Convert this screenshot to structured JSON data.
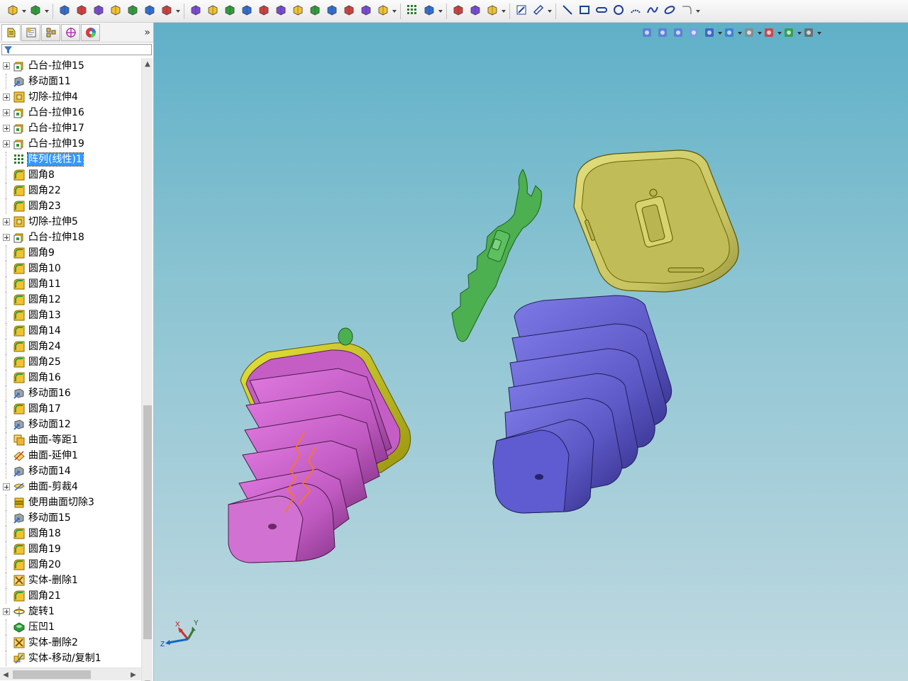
{
  "toolbar": {
    "groups": [
      [
        "boss-extrude-icon",
        "cut-extrude-icon"
      ],
      [
        "move-face-icon",
        "boss-icon",
        "revolve-icon",
        "sweep-icon",
        "loft-icon",
        "boundary-icon",
        "fillet-icon"
      ],
      [
        "extrude-surface-icon",
        "revolve-surface-icon",
        "sweep-surface-icon",
        "loft-surface-icon",
        "boundary-surface-icon",
        "fill-surface-icon",
        "offset-surface-icon",
        "extend-surface-icon",
        "trim-surface-icon",
        "thicken-icon",
        "cut-with-surface-icon",
        "knit-icon"
      ],
      [
        "linear-pattern-icon",
        "mirror-icon"
      ],
      [
        "reference-geometry-icon",
        "curves-icon",
        "instant3d-icon"
      ],
      [
        "sketch-icon",
        "smart-dimension-icon"
      ],
      [
        "line-icon",
        "rectangle-icon",
        "slot-icon",
        "circle-icon",
        "arc-icon",
        "spline-icon",
        "ellipse-icon",
        "trim-entities-icon"
      ]
    ]
  },
  "panel": {
    "tabs": [
      "feature-manager-icon",
      "property-manager-icon",
      "configuration-manager-icon",
      "dimxpert-manager-icon",
      "display-manager-icon"
    ],
    "expand_label": "»",
    "tree": [
      {
        "label": "凸台-拉伸15",
        "icon": "boss-extrude",
        "expandable": true
      },
      {
        "label": "移动面11",
        "icon": "move-face",
        "expandable": false
      },
      {
        "label": "切除-拉伸4",
        "icon": "cut-extrude",
        "expandable": true
      },
      {
        "label": "凸台-拉伸16",
        "icon": "boss-extrude",
        "expandable": true
      },
      {
        "label": "凸台-拉伸17",
        "icon": "boss-extrude",
        "expandable": true
      },
      {
        "label": "凸台-拉伸19",
        "icon": "boss-extrude",
        "expandable": true
      },
      {
        "label": "阵列(线性)1",
        "icon": "linear-pattern",
        "expandable": false,
        "selected": true
      },
      {
        "label": "圆角8",
        "icon": "fillet",
        "expandable": false
      },
      {
        "label": "圆角22",
        "icon": "fillet",
        "expandable": false
      },
      {
        "label": "圆角23",
        "icon": "fillet",
        "expandable": false
      },
      {
        "label": "切除-拉伸5",
        "icon": "cut-extrude",
        "expandable": true
      },
      {
        "label": "凸台-拉伸18",
        "icon": "boss-extrude",
        "expandable": true
      },
      {
        "label": "圆角9",
        "icon": "fillet",
        "expandable": false
      },
      {
        "label": "圆角10",
        "icon": "fillet",
        "expandable": false
      },
      {
        "label": "圆角11",
        "icon": "fillet",
        "expandable": false
      },
      {
        "label": "圆角12",
        "icon": "fillet",
        "expandable": false
      },
      {
        "label": "圆角13",
        "icon": "fillet",
        "expandable": false
      },
      {
        "label": "圆角14",
        "icon": "fillet",
        "expandable": false
      },
      {
        "label": "圆角24",
        "icon": "fillet",
        "expandable": false
      },
      {
        "label": "圆角25",
        "icon": "fillet",
        "expandable": false
      },
      {
        "label": "圆角16",
        "icon": "fillet",
        "expandable": false
      },
      {
        "label": "移动面16",
        "icon": "move-face",
        "expandable": false
      },
      {
        "label": "圆角17",
        "icon": "fillet",
        "expandable": false
      },
      {
        "label": "移动面12",
        "icon": "move-face",
        "expandable": false
      },
      {
        "label": "曲面-等距1",
        "icon": "offset-surface",
        "expandable": false
      },
      {
        "label": "曲面-延伸1",
        "icon": "extend-surface",
        "expandable": false
      },
      {
        "label": "移动面14",
        "icon": "move-face",
        "expandable": false
      },
      {
        "label": "曲面-剪裁4",
        "icon": "trim-surface",
        "expandable": true
      },
      {
        "label": "使用曲面切除3",
        "icon": "cut-with-surface",
        "expandable": false
      },
      {
        "label": "移动面15",
        "icon": "move-face",
        "expandable": false
      },
      {
        "label": "圆角18",
        "icon": "fillet",
        "expandable": false
      },
      {
        "label": "圆角19",
        "icon": "fillet",
        "expandable": false
      },
      {
        "label": "圆角20",
        "icon": "fillet",
        "expandable": false
      },
      {
        "label": "实体-删除1",
        "icon": "delete-body",
        "expandable": false
      },
      {
        "label": "圆角21",
        "icon": "fillet",
        "expandable": false
      },
      {
        "label": "旋转1",
        "icon": "revolve",
        "expandable": true
      },
      {
        "label": "压凹1",
        "icon": "indent",
        "expandable": false
      },
      {
        "label": "实体-删除2",
        "icon": "delete-body",
        "expandable": false
      },
      {
        "label": "实体-移动/复制1",
        "icon": "move-copy-body",
        "expandable": false
      }
    ]
  },
  "view_toolbar": [
    "zoom-to-fit-icon",
    "zoom-to-area-icon",
    "previous-view-icon",
    "section-view-icon",
    "view-orientation-icon",
    "display-style-icon",
    "hide-show-items-icon",
    "edit-appearance-icon",
    "apply-scene-icon",
    "view-settings-icon"
  ],
  "triad": {
    "x": "X",
    "y": "Y",
    "z": "Z"
  },
  "colors": {
    "viewport_top": "#5fb0c8",
    "viewport_bottom": "#c0d9e1",
    "pink_body": "#c65ac8",
    "yellow_rim": "#c8c51a",
    "purple_body": "#5e5ac8",
    "green_part": "#4caf50",
    "yellow_lid": "#c9c562",
    "selection": "#3399ff"
  }
}
